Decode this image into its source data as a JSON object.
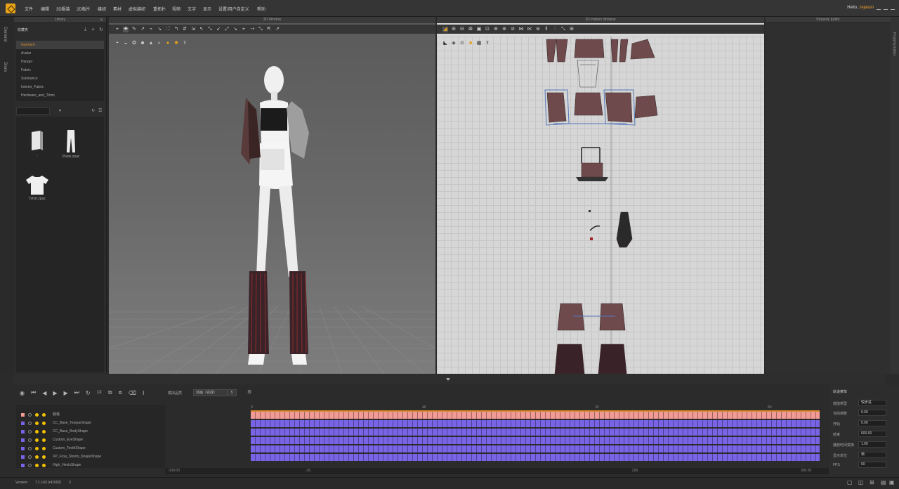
{
  "app": {
    "hello_prefix": "Hello,",
    "username": "zejason",
    "accent": "#e8a317"
  },
  "menu": [
    "文件",
    "编辑",
    "3D服装",
    "2D板片",
    "缝纫",
    "素材",
    "虚拟缝纫",
    "重拓扑",
    "视频",
    "文字",
    "显示",
    "设置/用户自定义",
    "帮助"
  ],
  "side_tabs": [
    "General",
    "Store"
  ],
  "library": {
    "title": "Library",
    "header_label": "收藏夹",
    "categories": [
      "Garment",
      "Avatar",
      "Hanger",
      "Fabric",
      "Substance",
      "Interior_Fabric",
      "Hardware_and_Trims"
    ],
    "selected": "Garment",
    "items": [
      {
        "label": "..",
        "icon": "folder-up-icon"
      },
      {
        "label": "Pants.zpac",
        "icon": "pants-icon"
      },
      {
        "label": "Tshirt.zpac",
        "icon": "tshirt-icon"
      }
    ]
  },
  "window3d": {
    "title": "3D Window"
  },
  "window2d": {
    "title": "2D Pattern Window"
  },
  "property_editor": {
    "title": "Property Editor",
    "side_tab": "Property Editor"
  },
  "animation": {
    "speed": "1X",
    "mode_label": "模拟品质",
    "mode_value": "动画（完成）",
    "fps_selector": "5",
    "layers": [
      {
        "name": "服装",
        "color": "#f29a95"
      },
      {
        "name": "CC_Base_TongueShape",
        "color": "#7a64e6"
      },
      {
        "name": "CC_Base_BodyShape",
        "color": "#7a64e6"
      },
      {
        "name": "Custom_EyeShape",
        "color": "#7a64e6"
      },
      {
        "name": "Custom_TeethShape",
        "color": "#7a64e6"
      },
      {
        "name": "XP_Foxy_Shorts_ShapeShape",
        "color": "#7a64e6"
      },
      {
        "name": "High_HeelsShape",
        "color": "#7a64e6"
      }
    ],
    "ruler_ticks": [
      "0",
      "40",
      "20",
      "80"
    ],
    "scroll_ticks": [
      "-100.00",
      "-30",
      "200",
      "300.00"
    ]
  },
  "track_props": {
    "title": "轨道菜单",
    "rows": [
      {
        "label": "插值类型",
        "value": "较步进"
      },
      {
        "label": "当前帧数",
        "value": "0.00"
      },
      {
        "label": "开始",
        "value": "0.00"
      },
      {
        "label": "结束",
        "value": "600.00"
      },
      {
        "label": "播放时间变换",
        "value": "1.00"
      },
      {
        "label": "显示单位",
        "value": "帧"
      },
      {
        "label": "FPS",
        "value": "60"
      }
    ]
  },
  "status": {
    "label": "Version:",
    "value": "7.1.143 (r41692)",
    "extra": "3"
  }
}
